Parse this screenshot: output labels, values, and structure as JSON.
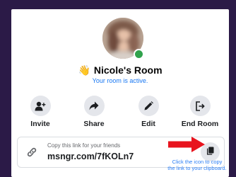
{
  "room": {
    "title_emoji": "👋",
    "title": "Nicole's Room",
    "status": "Your room is active."
  },
  "actions": [
    {
      "label": "Invite",
      "icon": "add-person-icon"
    },
    {
      "label": "Share",
      "icon": "share-arrow-icon"
    },
    {
      "label": "Edit",
      "icon": "pencil-icon"
    },
    {
      "label": "End Room",
      "icon": "exit-door-icon"
    }
  ],
  "link": {
    "hint": "Copy this link for your friends",
    "url": "msngr.com/7fKOLn7",
    "icon": "link-icon",
    "copy_icon": "copy-icon"
  },
  "annotation": {
    "line1": "Click the icon to copy",
    "line2": "the link to your clipboard."
  },
  "colors": {
    "frame": "#2b1a47",
    "accent": "#1877f2",
    "presence": "#31a24c",
    "arrow": "#e8141e",
    "annotation": "#2a7ef5"
  }
}
